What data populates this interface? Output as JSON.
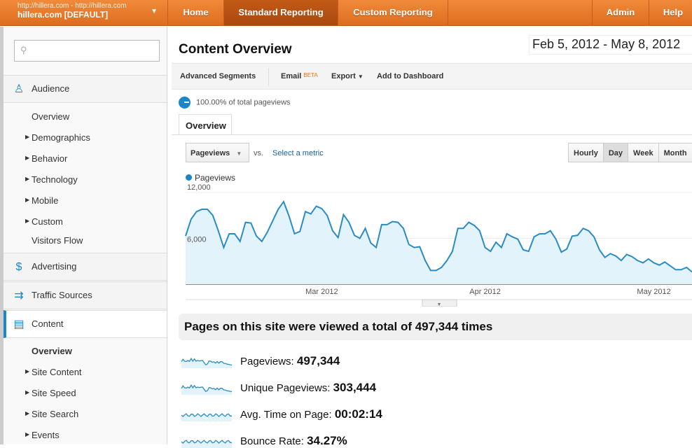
{
  "topbar": {
    "account_url": "http://hillera.com - http://hillera.com",
    "account_name": "hillera.com [DEFAULT]",
    "nav": [
      "Home",
      "Standard Reporting",
      "Custom Reporting",
      "Admin",
      "Help"
    ]
  },
  "sidebar": {
    "search_placeholder": "",
    "audience": {
      "label": "Audience",
      "items": [
        "Overview",
        "Demographics",
        "Behavior",
        "Technology",
        "Mobile",
        "Custom",
        "Visitors Flow"
      ]
    },
    "advertising": "Advertising",
    "traffic": "Traffic Sources",
    "content": {
      "label": "Content",
      "items": [
        "Overview",
        "Site Content",
        "Site Speed",
        "Site Search",
        "Events"
      ]
    }
  },
  "main": {
    "title": "Content Overview",
    "date_range": "Feb 5, 2012 - May 8, 2012",
    "toolbar": {
      "segments": "Advanced Segments",
      "email": "Email",
      "beta": "BETA",
      "export": "Export",
      "dashboard": "Add to Dashboard"
    },
    "percent_text": "100.00% of total pageviews",
    "tab": "Overview",
    "metric": "Pageviews",
    "vs": "vs.",
    "select_metric": "Select a metric",
    "granularity": [
      "Hourly",
      "Day",
      "Week",
      "Month"
    ],
    "selected_granularity": "Day",
    "summary": "Pages on this site were viewed a total of 497,344 times",
    "stats": [
      {
        "label": "Pageviews:",
        "value": "497,344"
      },
      {
        "label": "Unique Pageviews:",
        "value": "303,444"
      },
      {
        "label": "Avg. Time on Page:",
        "value": "00:02:14"
      },
      {
        "label": "Bounce Rate:",
        "value": "34.27%"
      }
    ]
  },
  "chart_data": {
    "type": "area",
    "series_name": "Pageviews",
    "ylim": [
      0,
      12000
    ],
    "yticks": [
      "12,000",
      "6,000"
    ],
    "xticks": [
      {
        "label": "Mar 2012",
        "index": 25
      },
      {
        "label": "Apr 2012",
        "index": 55
      },
      {
        "label": "May 2012",
        "index": 86
      }
    ],
    "colors": {
      "line": "#2b8cc4",
      "fill": "#e3f3fb"
    },
    "values": [
      6300,
      8500,
      9500,
      9800,
      9800,
      9000,
      7000,
      4800,
      6600,
      6600,
      5600,
      8100,
      8000,
      6300,
      5600,
      6800,
      8300,
      9800,
      10800,
      8900,
      6600,
      6900,
      9500,
      9200,
      10200,
      9900,
      9000,
      7000,
      6100,
      9100,
      8100,
      6400,
      6000,
      7300,
      5400,
      4800,
      7800,
      7800,
      8200,
      8100,
      7300,
      5200,
      4800,
      4900,
      3100,
      1800,
      1800,
      2200,
      3100,
      4300,
      7300,
      7300,
      8100,
      7700,
      7000,
      4800,
      4300,
      5500,
      4800,
      6600,
      6200,
      5900,
      4500,
      4300,
      6200,
      6600,
      6600,
      7000,
      5900,
      4200,
      4600,
      6300,
      6400,
      7300,
      7000,
      6200,
      4500,
      3500,
      4000,
      3700,
      3100,
      3900,
      3600,
      3100,
      2800,
      3300,
      2800,
      2500,
      2900,
      2400,
      1900,
      1900,
      2200,
      1600
    ]
  }
}
